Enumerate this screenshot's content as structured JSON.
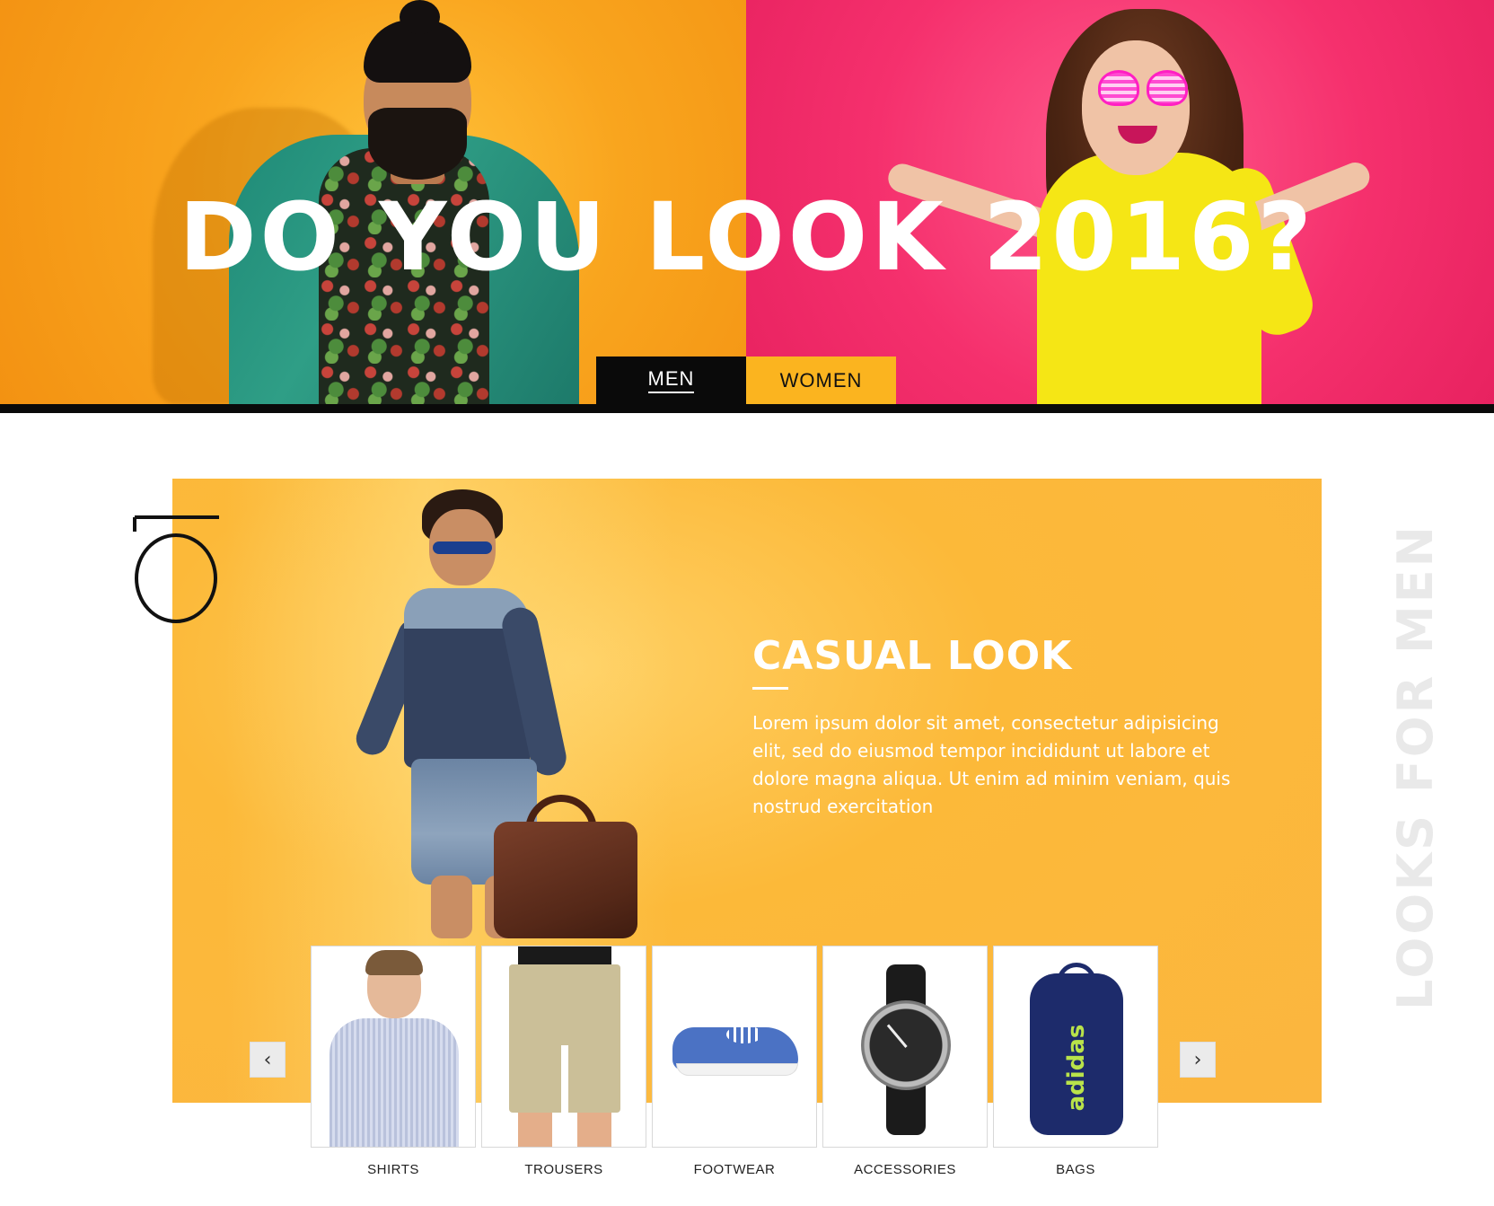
{
  "hero": {
    "title": "DO YOU LOOK 2016?",
    "tabs": [
      {
        "label": "MEN",
        "active": true
      },
      {
        "label": "WOMEN",
        "active": false
      }
    ],
    "colors": {
      "left_bg": "#f9a51e",
      "right_bg": "#f5306d",
      "tab_men_bg": "#0a0a0a",
      "tab_women_bg": "#fbb41f"
    }
  },
  "section": {
    "side_label": "LOOKS FOR MEN",
    "look": {
      "title": "CASUAL LOOK",
      "description": "Lorem ipsum dolor sit amet, consectetur adipisicing elit, sed do eiusmod tempor incididunt ut labore et dolore magna aliqua. Ut enim ad minim veniam, quis nostrud exercitation",
      "card_color": "#fbb63f"
    },
    "carousel": {
      "prev_icon": "chevron-left-icon",
      "next_icon": "chevron-right-icon",
      "prev_glyph": "‹",
      "next_glyph": "›",
      "products": [
        {
          "label": "SHIRTS"
        },
        {
          "label": "TROUSERS"
        },
        {
          "label": "FOOTWEAR"
        },
        {
          "label": "ACCESSORIES"
        },
        {
          "label": "BAGS"
        }
      ],
      "bag_brand": "adidas"
    }
  }
}
